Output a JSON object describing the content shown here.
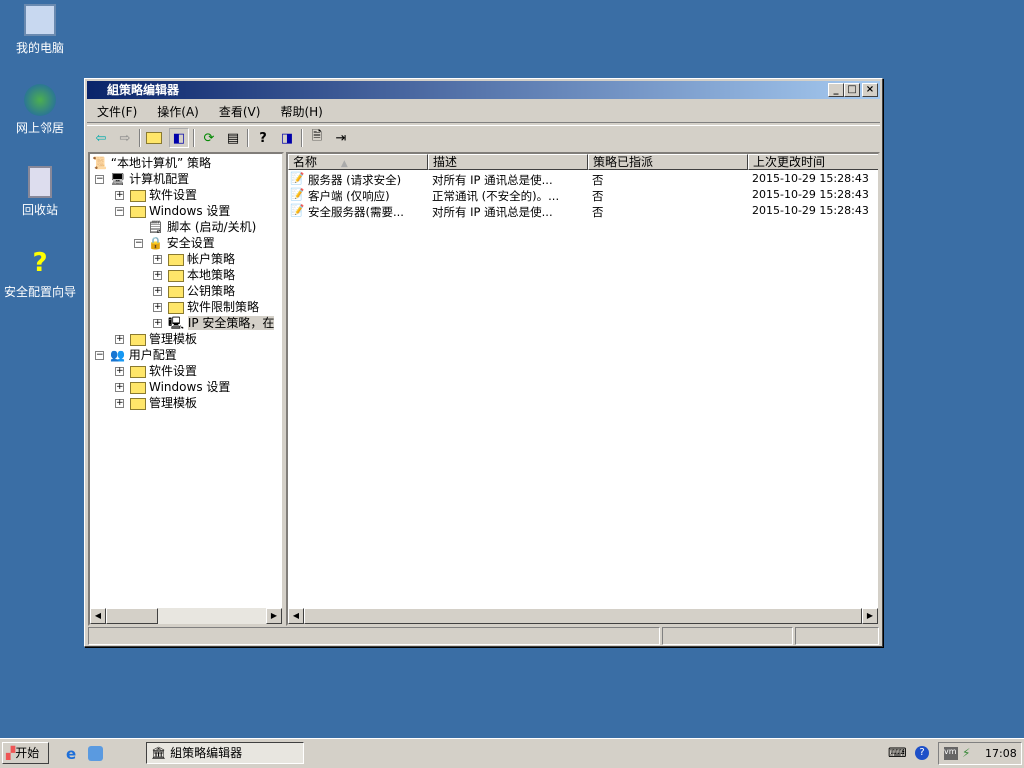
{
  "desktop": {
    "icons": [
      {
        "label": "我的电脑",
        "icon": "my-computer-icon"
      },
      {
        "label": "网上邻居",
        "icon": "network-icon"
      },
      {
        "label": "回收站",
        "icon": "recycle-bin-icon"
      },
      {
        "label": "安全配置向导",
        "icon": "security-wizard-icon"
      }
    ]
  },
  "window": {
    "title": "組策略编辑器",
    "menu": [
      "文件(F)",
      "操作(A)",
      "查看(V)",
      "帮助(H)"
    ],
    "tree": [
      {
        "label": "“本地计算机” 策略"
      },
      {
        "label": "计算机配置"
      },
      {
        "label": "软件设置"
      },
      {
        "label": "Windows 设置"
      },
      {
        "label": "脚本 (启动/关机)"
      },
      {
        "label": "安全设置"
      },
      {
        "label": "帐户策略"
      },
      {
        "label": "本地策略"
      },
      {
        "label": "公钥策略"
      },
      {
        "label": "软件限制策略"
      },
      {
        "label": "IP 安全策略，在"
      },
      {
        "label": "管理模板"
      },
      {
        "label": "用户配置"
      },
      {
        "label": "软件设置"
      },
      {
        "label": "Windows 设置"
      },
      {
        "label": "管理模板"
      }
    ],
    "columns": [
      "名称",
      "描述",
      "策略已指派",
      "上次更改时间"
    ],
    "rows": [
      [
        "服务器 (请求安全)",
        "对所有 IP 通讯总是使...",
        "否",
        "2015-10-29 15:28:43"
      ],
      [
        "客户端 (仅响应)",
        "正常通讯 (不安全的)。...",
        "否",
        "2015-10-29 15:28:43"
      ],
      [
        "安全服务器(需要...",
        "对所有 IP 通讯总是使...",
        "否",
        "2015-10-29 15:28:43"
      ]
    ]
  },
  "taskbar": {
    "start": "开始",
    "task": "組策略编辑器",
    "clock": "17:08"
  }
}
